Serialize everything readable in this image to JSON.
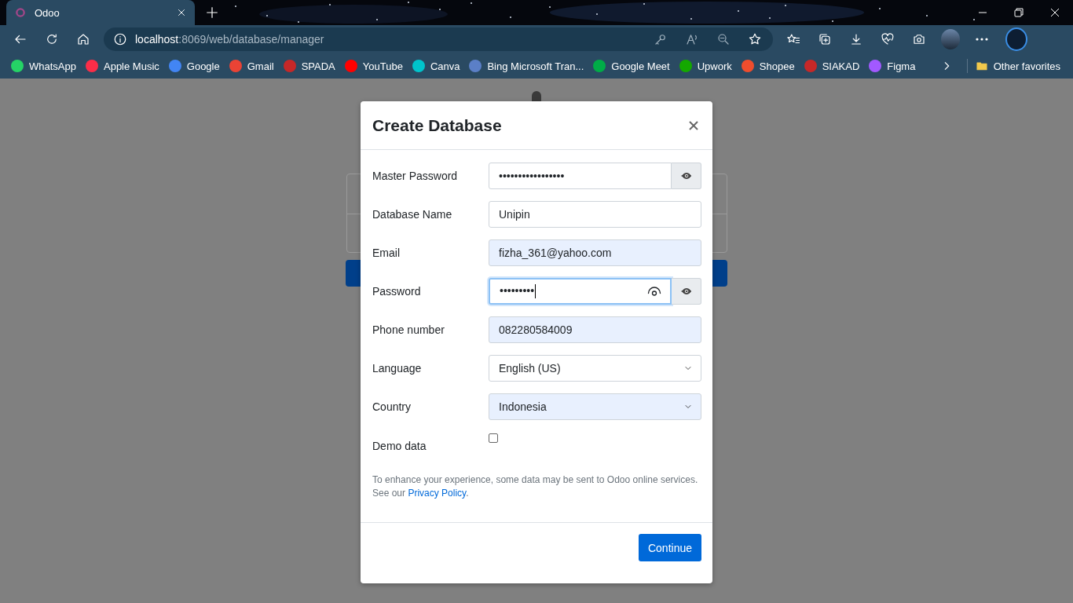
{
  "browser": {
    "tab": {
      "title": "Odoo",
      "selected": true
    },
    "address": {
      "host": "localhost",
      "path": ":8069/web/database/manager"
    },
    "bookmarks": [
      {
        "label": "WhatsApp",
        "color": "#25d366"
      },
      {
        "label": "Apple Music",
        "color": "#fa2d48"
      },
      {
        "label": "Google",
        "color": "#4285f4"
      },
      {
        "label": "Gmail",
        "color": "#ea4335"
      },
      {
        "label": "SPADA",
        "color": "#c62828"
      },
      {
        "label": "YouTube",
        "color": "#ff0000"
      },
      {
        "label": "Canva",
        "color": "#00c4cc"
      },
      {
        "label": "Bing Microsoft Tran...",
        "color": "#5b7fc7"
      },
      {
        "label": "Google Meet",
        "color": "#00ac47"
      },
      {
        "label": "Upwork",
        "color": "#14a800"
      },
      {
        "label": "Shopee",
        "color": "#ee4d2d"
      },
      {
        "label": "SIAKAD",
        "color": "#c62828"
      },
      {
        "label": "Figma",
        "color": "#a259ff"
      }
    ],
    "other_favorites": "Other favorites"
  },
  "dialog": {
    "title": "Create Database",
    "fields": [
      {
        "kind": "password",
        "label": "Master Password",
        "value": "•••••••••••••••••",
        "autofilled": false,
        "focused": false
      },
      {
        "kind": "text",
        "label": "Database Name",
        "value": "Unipin",
        "autofilled": false,
        "focused": false
      },
      {
        "kind": "text",
        "label": "Email",
        "value": "fizha_361@yahoo.com",
        "autofilled": true,
        "focused": false
      },
      {
        "kind": "password",
        "label": "Password",
        "value": "•••••••••",
        "autofilled": false,
        "focused": true
      },
      {
        "kind": "text",
        "label": "Phone number",
        "value": "082280584009",
        "autofilled": true,
        "focused": false
      },
      {
        "kind": "select",
        "label": "Language",
        "value": "English (US)",
        "autofilled": false,
        "focused": false
      },
      {
        "kind": "select",
        "label": "Country",
        "value": "Indonesia",
        "autofilled": true,
        "focused": false
      },
      {
        "kind": "checkbox",
        "label": "Demo data",
        "checked": false
      }
    ],
    "note_before": "To enhance your experience, some data may be sent to Odoo online services. See our ",
    "note_link": "Privacy Policy",
    "note_after": ".",
    "button": "Continue"
  }
}
